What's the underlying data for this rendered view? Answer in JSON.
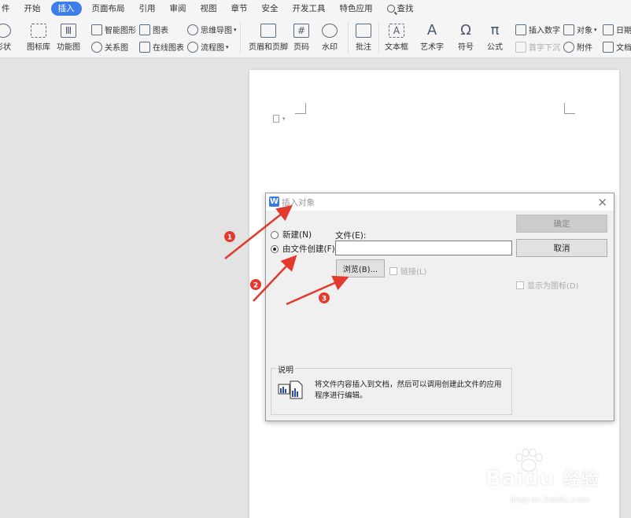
{
  "menu": {
    "items": [
      {
        "label": "件",
        "active": false
      },
      {
        "label": "开始",
        "active": false
      },
      {
        "label": "插入",
        "active": true
      },
      {
        "label": "页面布局",
        "active": false
      },
      {
        "label": "引用",
        "active": false
      },
      {
        "label": "审阅",
        "active": false
      },
      {
        "label": "视图",
        "active": false
      },
      {
        "label": "章节",
        "active": false
      },
      {
        "label": "安全",
        "active": false
      },
      {
        "label": "开发工具",
        "active": false
      },
      {
        "label": "特色应用",
        "active": false
      }
    ],
    "search_label": "查找"
  },
  "ribbon": {
    "shape": "形状",
    "icon_lib": "图标库",
    "func_chart": "功能图",
    "smart_art": "智能图形",
    "relation": "关系图",
    "chart": "图表",
    "online_chart": "在线图表",
    "mind_map": "思维导图",
    "flow_chart": "流程图",
    "header_footer": "页眉和页脚",
    "page_number": "页码",
    "watermark": "水印",
    "comment": "批注",
    "text_box": "文本框",
    "word_art": "艺术字",
    "symbol": "符号",
    "formula": "公式",
    "insert_number": "插入数字",
    "drop_cap": "首字下沉",
    "object": "对象",
    "attachment": "附件",
    "date": "日期",
    "document": "文档"
  },
  "dialog": {
    "title": "插入对象",
    "close": "×",
    "radio_new": "新建(N)",
    "radio_from_file": "由文件创建(F)",
    "file_label": "文件(E):",
    "file_value": "",
    "browse": "浏览(B)...",
    "link": "链接(L)",
    "display_as_icon": "显示为图标(D)",
    "ok": "确定",
    "cancel": "取消",
    "desc_title": "说明",
    "desc_text": "将文件内容插入到文档，然后可以调用创建此文件的应用程序进行编辑。"
  },
  "annotations": [
    {
      "number": "1",
      "color": "#e23a2e"
    },
    {
      "number": "2",
      "color": "#e23a2e"
    },
    {
      "number": "3",
      "color": "#e23a2e"
    }
  ],
  "watermark": {
    "brand": "Bai",
    "brand2": "du",
    "brand_cn": "经验",
    "url": "jingyan.baidu.com"
  },
  "colors": {
    "accent": "#3f7ee8",
    "annotation": "#e23a2e"
  }
}
